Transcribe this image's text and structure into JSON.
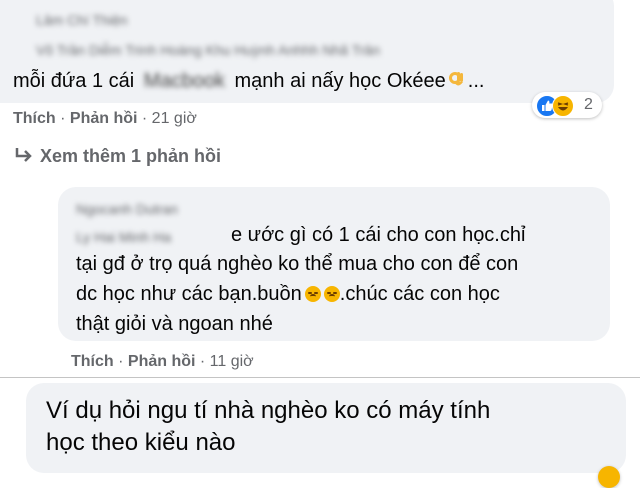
{
  "comment1": {
    "names_blurred": "Lâm Chí Thiện",
    "tags_blurred": "Võ Trần Diễm Trinh Hoàng Khu Huỳnh Anhhh Nhã Trân",
    "text_before": "mỗi đứa 1 cái",
    "tag_blurred": "Macbook",
    "text_after": "mạnh ai nấy học Okéee",
    "text_end": "...",
    "like": "Thích",
    "reply": "Phản hồi",
    "time": "21 giờ",
    "reaction_count": "2"
  },
  "see_more": {
    "label": "Xem thêm 1 phản hồi"
  },
  "comment2": {
    "name_blurred": "Ngocanh Dutran",
    "tag_blurred": "Ly Hai Minh Ha",
    "line1": "e ước gì có 1 cái cho con học.chỉ",
    "line2": "tại gđ ở trọ quá nghèo ko thể mua cho con để con",
    "line3_before": "dc học như các bạn.buồn",
    "line3_after": ".chúc các con học",
    "line4": "thật giỏi và ngoan nhé",
    "like": "Thích",
    "reply": "Phản hồi",
    "time": "11 giờ"
  },
  "comment3": {
    "line1": "Ví dụ hỏi ngu tí nhà nghèo ko có máy tính",
    "line2": "học theo kiểu nào"
  },
  "colors": {
    "bubble": "#f0f2f5",
    "meta_text": "#65676b",
    "like_blue": "#1877f2",
    "haha_yellow": "#f7b500"
  }
}
